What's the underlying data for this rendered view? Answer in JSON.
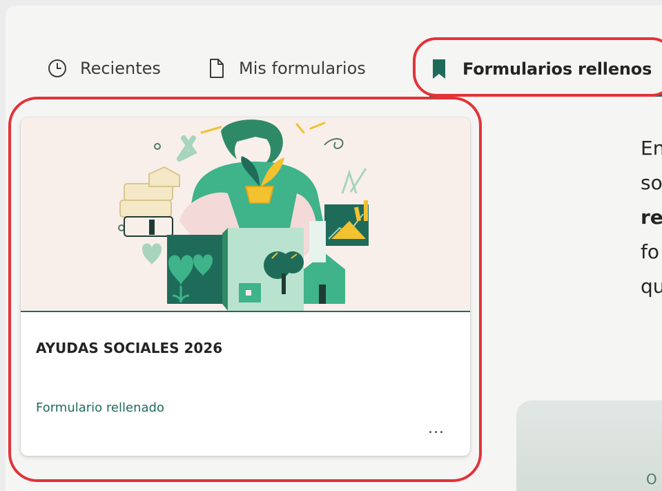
{
  "tabs": {
    "recent": "Recientes",
    "mine": "Mis formularios",
    "filled": "Formularios rellenos"
  },
  "card": {
    "title": "AYUDAS SOCIALES 2026",
    "status": "Formulario rellenado",
    "more": "..."
  },
  "side_text": [
    "En",
    "so",
    "re",
    "fo",
    "qu"
  ],
  "promo": {
    "dot": "O"
  },
  "colors": {
    "accent": "#1f6b5a",
    "highlight": "#e33238",
    "illustration_bg": "#f8efeb"
  },
  "icons": [
    "clock-icon",
    "document-icon",
    "bookmark-icon",
    "more-icon"
  ]
}
